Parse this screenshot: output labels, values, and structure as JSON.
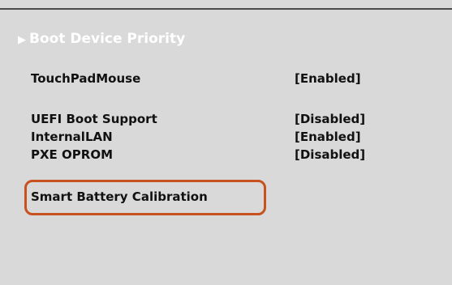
{
  "menu": {
    "boot_device_priority": "Boot Device Priority",
    "items": [
      {
        "label": "TouchPadMouse",
        "value": "[Enabled]"
      },
      {
        "label": "UEFI Boot Support",
        "value": "[Disabled]"
      },
      {
        "label": "InternalLAN",
        "value": "[Enabled]"
      },
      {
        "label": "PXE OPROM",
        "value": "[Disabled]"
      },
      {
        "label": "Smart Battery Calibration",
        "value": ""
      }
    ]
  },
  "colors": {
    "background": "#d9d9d9",
    "highlight_accent": "#c7511f",
    "submenu_text": "#ffffff"
  },
  "icons": {
    "submenu_arrow": "right-triangle-icon"
  }
}
